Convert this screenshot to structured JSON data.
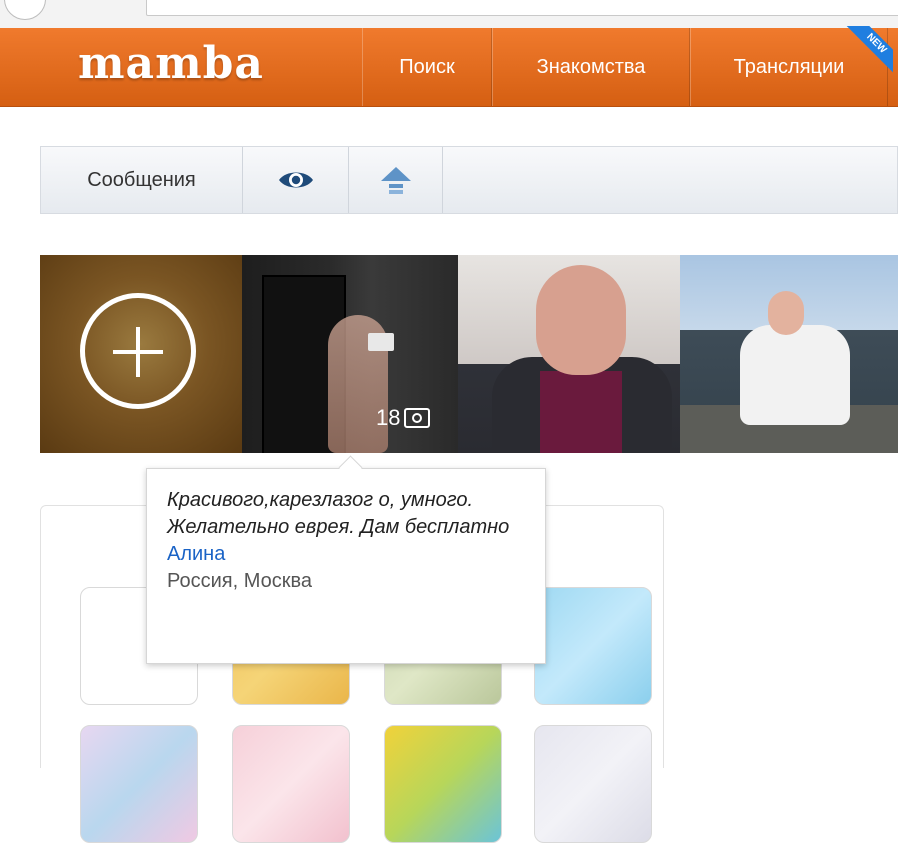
{
  "header": {
    "logo": "mamba",
    "nav": [
      {
        "label": "Поиск"
      },
      {
        "label": "Знакомства"
      },
      {
        "label": "Трансляции",
        "badge": "NEW"
      }
    ]
  },
  "toolbar": {
    "messages_label": "Сообщения",
    "eye_icon": "eye-icon",
    "up_icon": "arrow-up-icon"
  },
  "photos": {
    "add_icon": "plus-icon",
    "items": [
      {
        "count": "18"
      },
      {},
      {}
    ]
  },
  "tooltip": {
    "text": "Красивого,карезлазог о, умного. Желательно еврея. Дам бесплатно",
    "name": "Алина",
    "location": "Россия, Москва"
  },
  "colors": {
    "header": "#e86f1f",
    "link": "#1a63c6",
    "new_badge": "#1f7ee0"
  }
}
